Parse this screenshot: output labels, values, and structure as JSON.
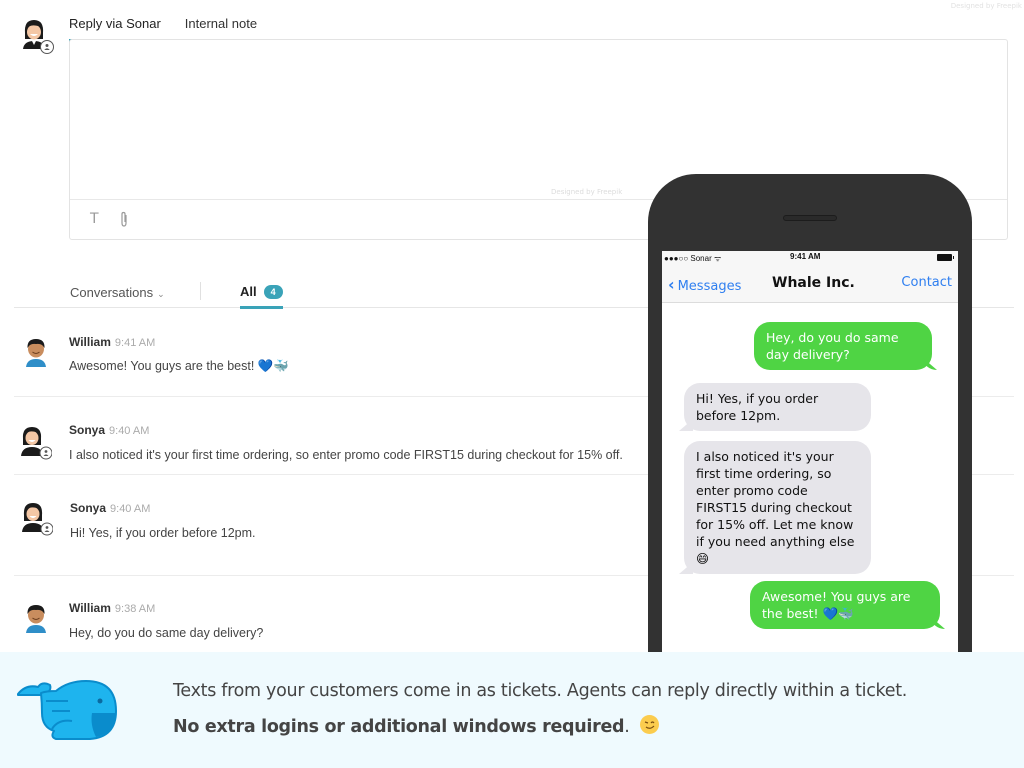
{
  "credit": "Designed by Freepik",
  "composer": {
    "tabs": [
      {
        "label": "Reply via Sonar",
        "active": true
      },
      {
        "label": "Internal note",
        "active": false
      }
    ],
    "text_value": "",
    "credit": "Designed by Freepik",
    "tools": [
      {
        "name": "text-format-icon",
        "glyph": "T"
      },
      {
        "name": "attachment-icon",
        "glyph": "📎"
      }
    ]
  },
  "list_header": {
    "dropdown_label": "Conversations",
    "all_label": "All",
    "all_count": "4"
  },
  "conversations": [
    {
      "name": "William",
      "time": "9:41 AM",
      "message": "Awesome! You guys are the best! 💙🐳",
      "avatar": "male"
    },
    {
      "name": "Sonya",
      "time": "9:40 AM",
      "message": "I also noticed it's your first time ordering, so enter promo code FIRST15 during checkout for 15% off.",
      "avatar": "female"
    },
    {
      "name": "Sonya",
      "time": "9:40 AM",
      "message": "Hi! Yes, if you order before 12pm.",
      "avatar": "female"
    },
    {
      "name": "William",
      "time": "9:38 AM",
      "message": "Hey, do you do same day delivery?",
      "avatar": "male"
    }
  ],
  "phone": {
    "status": {
      "carrier": "●●●○○ Sonar",
      "time": "9:41 AM"
    },
    "nav": {
      "back_label": "Messages",
      "title": "Whale Inc.",
      "action_label": "Contact"
    },
    "messages": [
      {
        "direction": "out",
        "text": "Hey, do you do same day delivery?"
      },
      {
        "direction": "in",
        "text": "Hi! Yes, if you order before 12pm."
      },
      {
        "direction": "in",
        "text": "I also noticed it's your first time ordering, so enter promo code FIRST15 during checkout for 15% off. Let me know if you need anything else 😄"
      },
      {
        "direction": "out",
        "text": "Awesome! You guys are the best! 💙🐳"
      }
    ]
  },
  "footer": {
    "line1": "Texts from your customers come in as tickets. Agents can reply directly within a ticket.",
    "line2_bold": "No extra logins or additional windows required",
    "line2_tail": "."
  },
  "colors": {
    "accent": "#3aa3b8",
    "ios_blue": "#2f7ff0",
    "bubble_out": "#4fd444",
    "bubble_in": "#e6e5ea",
    "footer_bg": "#effafe",
    "whale": "#1eb4ee"
  }
}
